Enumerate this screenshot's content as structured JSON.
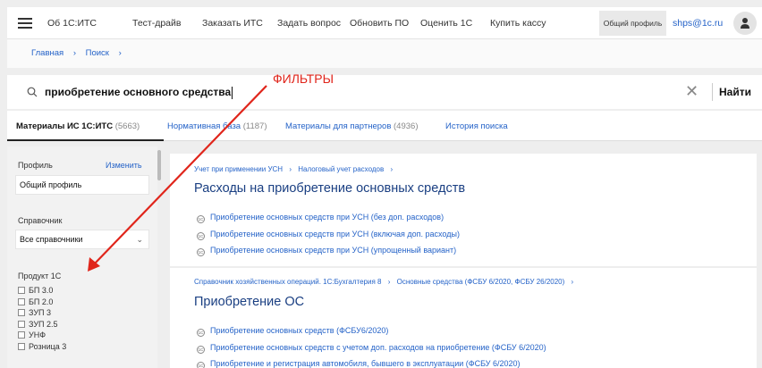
{
  "topbar": {
    "nav": [
      "Об 1С:ИТС",
      "Тест-драйв",
      "Заказать ИТС",
      "Задать вопрос",
      "Обновить ПО",
      "Оценить 1С",
      "Купить кассу"
    ],
    "profile_button": "Общий профиль",
    "email": "shps@1c.ru"
  },
  "breadcrumb": [
    "Главная",
    "›",
    "Поиск",
    "›"
  ],
  "search": {
    "query": "приобретение основного средства",
    "button": "Найти"
  },
  "tabs": [
    {
      "label": "Материалы ИС 1С:ИТС",
      "count": "(5663)",
      "active": true
    },
    {
      "label": "Нормативная база",
      "count": "(1187)",
      "active": false
    },
    {
      "label": "Материалы для партнеров",
      "count": "(4936)",
      "active": false
    },
    {
      "label": "История поиска",
      "count": "",
      "active": false
    }
  ],
  "sidebar": {
    "profile_label": "Профиль",
    "profile_change": "Изменить",
    "profile_value": "Общий профиль",
    "reference_label": "Справочник",
    "reference_value": "Все справочники",
    "product_label": "Продукт 1С",
    "products": [
      "БП 3.0",
      "БП 2.0",
      "ЗУП 3",
      "ЗУП 2.5",
      "УНФ",
      "Розница 3"
    ]
  },
  "results": [
    {
      "crumbs": [
        "Учет при применении УСН",
        "›",
        "Налоговый учет расходов",
        "›"
      ],
      "title": "Расходы на приобретение основных средств",
      "links": [
        "Приобретение основных средств при УСН (без доп. расходов)",
        "Приобретение основных средств при УСН (включая доп. расходы)",
        "Приобретение основных средств при УСН (упрощенный вариант)"
      ]
    },
    {
      "crumbs": [
        "Справочник хозяйственных операций. 1С:Бухгалтерия 8",
        "›",
        "Основные средства (ФСБУ 6/2020, ФСБУ 26/2020)",
        "›"
      ],
      "title": "Приобретение ОС",
      "links": [
        "Приобретение основных средств (ФСБУ6/2020)",
        "Приобретение основных средств с учетом доп. расходов на приобретение (ФСБУ 6/2020)",
        "Приобретение и регистрация автомобиля, бывшего в эксплуатации (ФСБУ 6/2020)"
      ]
    }
  ],
  "annotation": {
    "label": "ФИЛЬТРЫ",
    "color": "#e0251b"
  },
  "icons": {
    "menu": "hamburger-icon",
    "search": "search-icon",
    "clear": "close-icon",
    "user": "user-icon",
    "badge": "1c-badge-icon"
  },
  "colors": {
    "link": "#2563c8",
    "title": "#1a3f82"
  }
}
